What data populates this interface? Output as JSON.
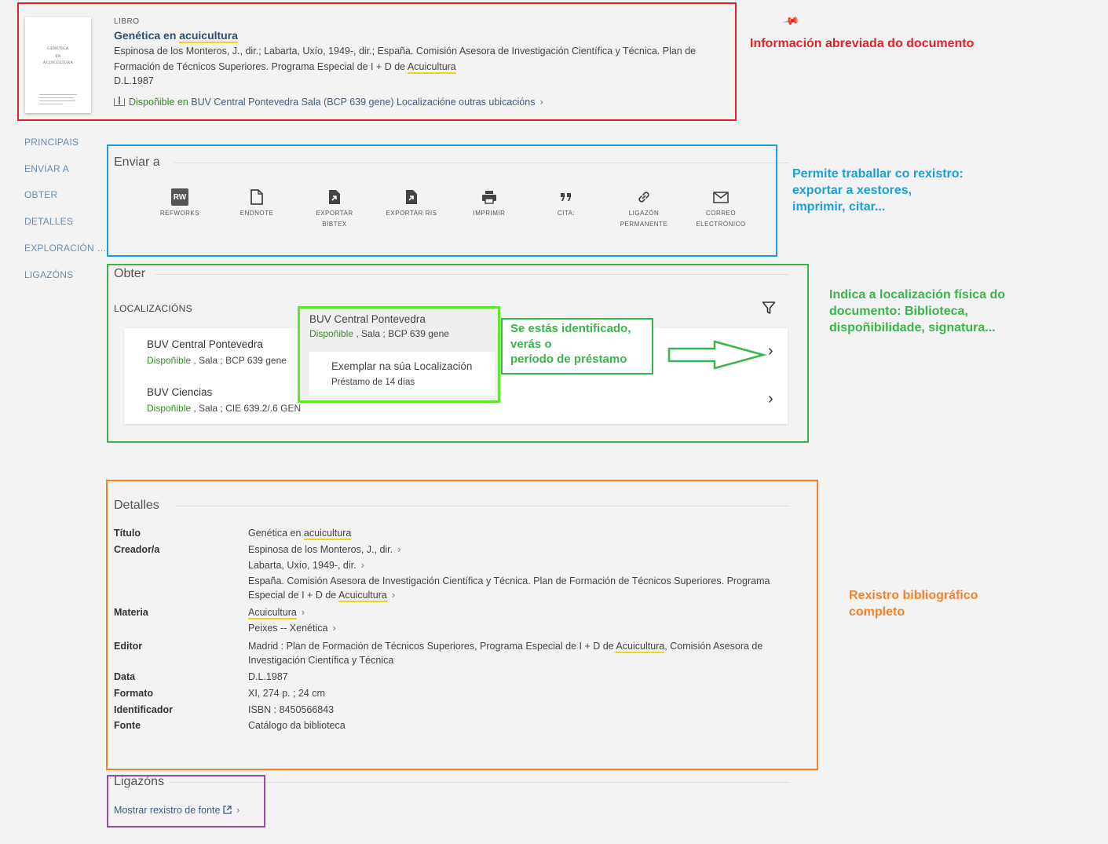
{
  "record": {
    "type": "LIBRO",
    "title_pre": "Genética en ",
    "title_hl": "acuicultura",
    "authors_pre": "Espinosa de los Monteros, J., dir.; Labarta, Uxío, 1949-, dir.; España. Comisión Asesora de Investigación Científica y Técnica. Plan de Formación de Técnicos Superiores. Programa Especial de I + D de ",
    "authors_hl": "Acuicultura",
    "date": "D.L.1987",
    "avail_status": "Dispoñible en",
    "avail_location": "BUV Central Pontevedra  Sala (BCP 639 gene) Localizacióne outras ubicacións",
    "cover_title": "GENETICA EN ACUICULTURA"
  },
  "nav": [
    "PRINCIPAIS",
    "ENVIAR A",
    "OBTER",
    "DETALLES",
    "EXPLORACIÓN VI...",
    "LIGAZÓNS"
  ],
  "send_to": {
    "heading": "Enviar a",
    "actions": [
      {
        "label": "REFWORKS",
        "icon": "refworks-icon"
      },
      {
        "label": "ENDNOTE",
        "icon": "file-icon"
      },
      {
        "label": "EXPORTAR BIBTEX",
        "icon": "export-file-icon"
      },
      {
        "label": "EXPORTAR RIS",
        "icon": "export-file-icon"
      },
      {
        "label": "IMPRIMIR",
        "icon": "print-icon"
      },
      {
        "label": "CITA:",
        "icon": "quote-icon"
      },
      {
        "label": "LIGAZÓN PERMANENTE",
        "icon": "link-icon"
      },
      {
        "label": "CORREO ELECTRÓNICO",
        "icon": "mail-icon"
      }
    ]
  },
  "obter": {
    "heading": "Obter",
    "locations_label": "LOCALIZACIÓNS",
    "locations": [
      {
        "name": "BUV Central Pontevedra",
        "status": "Dispoñible",
        "detail": " , Sala ; BCP 639 gene"
      },
      {
        "name": "BUV Ciencias",
        "status": "Dispoñible",
        "detail": " , Sala ; CIE 639.2/.6 GEN"
      }
    ],
    "popover": {
      "name": "BUV Central Pontevedra",
      "status": "Dispoñible",
      "detail": " , Sala ; BCP 639 gene",
      "item_title": "Exemplar na súa Localización",
      "loan": "Préstamo de 14 días"
    }
  },
  "annotations": {
    "summary": "Información abreviada do documento",
    "send": [
      "Permite traballar co rexistro:",
      "exportar a xestores,",
      "imprimir, citar..."
    ],
    "location": [
      "Indica a localización física do",
      "documento: Biblioteca,",
      "dispoñibilidade, signatura..."
    ],
    "loan": [
      "Se estás identificado,",
      "verás o",
      "período de préstamo"
    ],
    "full": [
      "Rexistro bibliográfico",
      "completo"
    ],
    "colors": {
      "red": "#e0222b",
      "blue": "#1aa0dc",
      "green": "#3ab54a",
      "lime": "#5ee62e",
      "orange": "#f5822a",
      "purple": "#9b4aa8"
    }
  },
  "details": {
    "heading": "Detalles",
    "rows": [
      {
        "label": "Título",
        "values": [
          {
            "pre": "Genética en ",
            "hl": "acuicultura",
            "post": "",
            "link": false
          }
        ]
      },
      {
        "label": "Creador/a",
        "values": [
          {
            "pre": "Espinosa de los Monteros, J., dir.",
            "hl": "",
            "post": "",
            "link": true
          },
          {
            "pre": "Labarta, Uxío, 1949-, dir.",
            "hl": "",
            "post": "",
            "link": true
          },
          {
            "pre": "España. Comisión Asesora de Investigación Científica y Técnica. Plan de Formación de Técnicos Superiores. Programa Especial de I + D de ",
            "hl": "Acuicultura",
            "post": "",
            "link": true
          }
        ]
      },
      {
        "label": "Materia",
        "values": [
          {
            "pre": "",
            "hl": "Acuicultura",
            "post": "",
            "link": true
          },
          {
            "pre": "Peixes -- Xenética",
            "hl": "",
            "post": "",
            "link": true
          }
        ]
      },
      {
        "label": "Editor",
        "values": [
          {
            "pre": "Madrid : Plan de Formación de Técnicos Superiores, Programa Especial de I + D de ",
            "hl": "Acuicultura",
            "post": ", Comisión Asesora de Investigación Científica y Técnica",
            "link": false
          }
        ]
      },
      {
        "label": "Data",
        "values": [
          {
            "pre": "D.L.1987",
            "hl": "",
            "post": "",
            "link": false
          }
        ]
      },
      {
        "label": "Formato",
        "values": [
          {
            "pre": "XI, 274 p. ; 24 cm",
            "hl": "",
            "post": "",
            "link": false
          }
        ]
      },
      {
        "label": "Identificador",
        "values": [
          {
            "pre": "ISBN : 8450566843",
            "hl": "",
            "post": "",
            "link": false
          }
        ]
      },
      {
        "label": "Fonte",
        "values": [
          {
            "pre": "Catálogo da biblioteca",
            "hl": "",
            "post": "",
            "link": false
          }
        ]
      }
    ]
  },
  "links": {
    "heading": "Ligazóns",
    "show_source": "Mostrar rexistro de fonte"
  }
}
